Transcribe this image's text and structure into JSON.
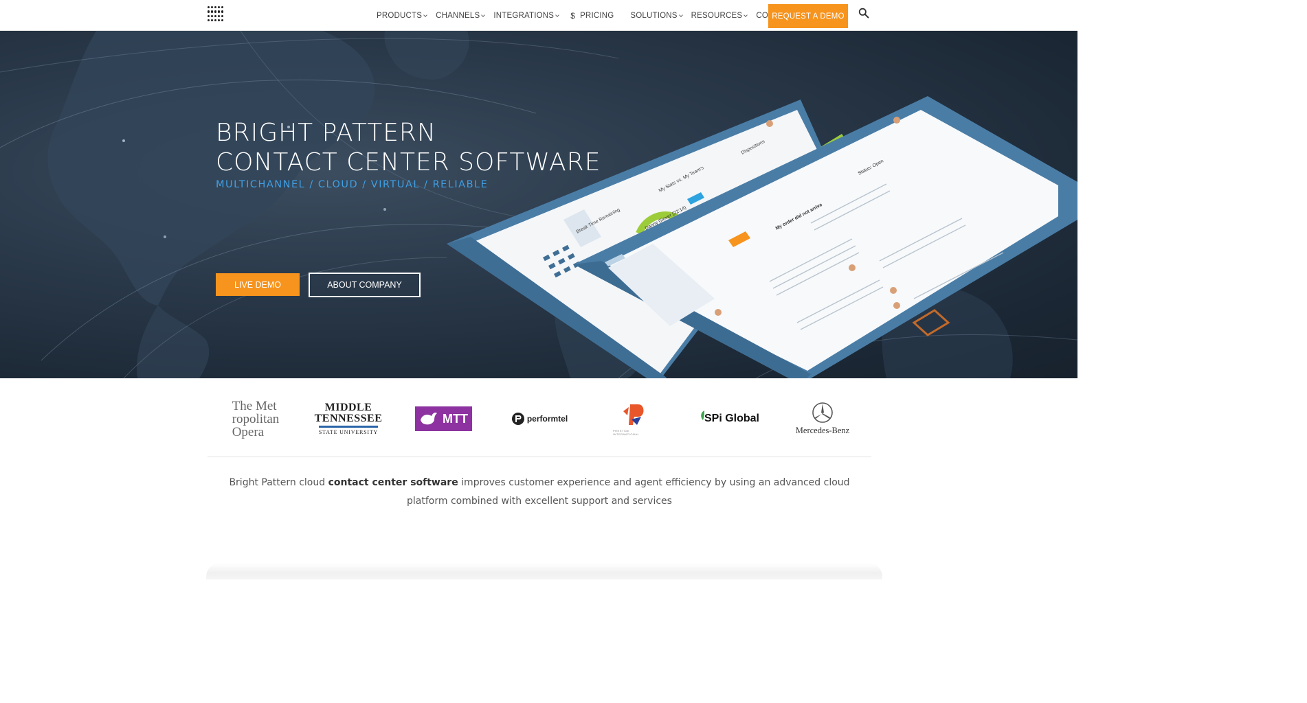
{
  "nav": {
    "items": [
      {
        "label": "PRODUCTS",
        "dropdown": true
      },
      {
        "label": "CHANNELS",
        "dropdown": true
      },
      {
        "label": "INTEGRATIONS",
        "dropdown": true
      },
      {
        "label": "PRICING",
        "dropdown": false,
        "icon": "dollar-icon"
      },
      {
        "label": "SOLUTIONS",
        "dropdown": true
      },
      {
        "label": "RESOURCES",
        "dropdown": true
      },
      {
        "label": "COMPANY",
        "dropdown": true
      }
    ],
    "dollar_symbol": "$",
    "cta_label": "REQUEST A DEMO",
    "search_icon": "search-icon",
    "logo_icon": "bright-pattern-dots-logo"
  },
  "hero": {
    "title_line1": "BRIGHT PATTERN",
    "title_line2": "CONTACT CENTER SOFTWARE",
    "subtitle": "MULTICHANNEL / CLOUD / VIRTUAL / RELIABLE",
    "primary_button": "LIVE DEMO",
    "secondary_button": "ABOUT COMPANY",
    "accent_color": "#f7941d",
    "subtitle_color": "#3fa0e6",
    "screens": {
      "back": {
        "break_label": "Break Time Remaining",
        "stats_label": "My Stats vs. My Team's",
        "dispositions_label": "Dispositions"
      },
      "front": {
        "agent_name": "Danny Glover (22:14)",
        "message_title": "My order did not arrive",
        "status": "Status: Open"
      }
    }
  },
  "clients": {
    "met": [
      "The Met",
      "ropolitan",
      "Opera"
    ],
    "mtsu": [
      "MIDDLE",
      "TENNESSEE",
      "STATE UNIVERSITY"
    ],
    "mtt": "MTT",
    "performtel": "performtel",
    "prestige": "PRESTIGE INTERNATIONAL",
    "spi": "SPi Global",
    "mercedes": "Mercedes-Benz"
  },
  "description": {
    "before": "Bright Pattern cloud ",
    "bold": "contact center software",
    "after": " improves customer experience and agent efficiency by using an advanced cloud platform combined with excellent support and services"
  }
}
